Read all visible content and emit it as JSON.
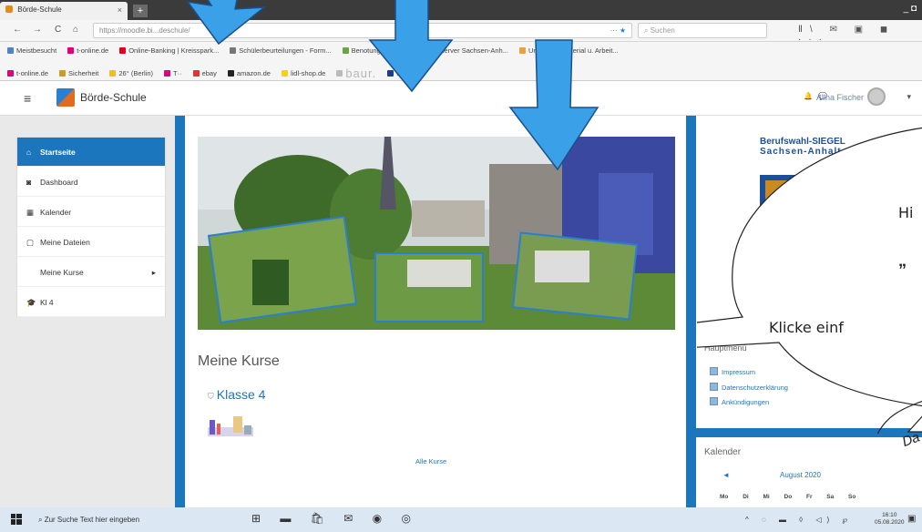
{
  "browser": {
    "tab_title": "Börde-Schule",
    "tab_close": "×",
    "new_tab": "+",
    "window_controls": "_ ◘",
    "nav": {
      "back": "←",
      "forward": "→",
      "reload": "C",
      "home": "⌂"
    },
    "url": "https://moodle.bi...deschule/",
    "url_suffix": "··· ★",
    "search_placeholder": "Suchen",
    "toolbar_icons": "Ⅱ\\ ✉ ▣ ◼ ···",
    "overflow": "···"
  },
  "bookmarks_row1": [
    {
      "label": "Meistbesucht",
      "color": "#4a86c5"
    },
    {
      "label": "t-online.de",
      "color": "#e0007a"
    },
    {
      "label": "Online-Banking | Kreisspark...",
      "color": "#e3001b"
    },
    {
      "label": "Schülerbeurteilungen - Form...",
      "color": "#777777"
    },
    {
      "label": "Benotung | fuxNot...",
      "color": "#6aa33f"
    },
    {
      "label": "...sserver Sachsen-Anh...",
      "color": "#888888"
    },
    {
      "label": "Unterrichtsmaterial u. Arbeit...",
      "color": "#e8a33a"
    }
  ],
  "bookmarks_row2": [
    {
      "label": "t-online.de",
      "color": "#e0007a"
    },
    {
      "label": "Sicherheit",
      "color": "#d09a2a"
    },
    {
      "label": "26° (Berlin)",
      "color": "#f4c20d"
    },
    {
      "label": "T··",
      "color": "#e0007a"
    },
    {
      "label": "ebay",
      "color": "#e53238"
    },
    {
      "label": "amazon.de",
      "color": "#222222"
    },
    {
      "label": "lidl-shop.de",
      "color": "#f7d400"
    },
    {
      "label": "baur.",
      "color": "#bbbbbb"
    },
    {
      "label": "Mobile",
      "color": "#1b3d8b"
    }
  ],
  "header": {
    "menu": "≡",
    "site_name": "Börde-Schule",
    "user_name": "Alina Fischer",
    "bell": "🔔",
    "chat": "💬",
    "caret": "▾"
  },
  "sidebar": {
    "items": [
      {
        "icon": "⌂",
        "label": "Startseite",
        "active": true
      },
      {
        "icon": "◙",
        "label": "Dashboard"
      },
      {
        "icon": "▦",
        "label": "Kalender"
      },
      {
        "icon": "▢",
        "label": "Meine Dateien"
      },
      {
        "icon": "",
        "label": "Meine Kurse",
        "caret": "▸"
      },
      {
        "icon": "🎓",
        "label": "Kl 4"
      }
    ]
  },
  "main": {
    "section_title": "Meine Kurse",
    "course": "Klasse 4",
    "course_icon": "⛉",
    "all_courses": "Alle Kurse"
  },
  "right": {
    "siegel_line1": "Berufswahl-SIEGEL",
    "siegel_line2": "Sachsen-Anhalt",
    "hauptmenu_title": "Hauptmenü",
    "hauptmenu_items": [
      "Impressum",
      "Datenschutzerklärung",
      "Ankündigungen"
    ],
    "calendar_title": "Kalender",
    "calendar_month": "August 2020",
    "calendar_prev": "◄",
    "calendar_days": "Mo Di Mi Do Fr Sa So"
  },
  "bubble": {
    "line1": "Hi",
    "line2": "„",
    "line3": "Klicke einf",
    "line4": "Da"
  },
  "taskbar": {
    "search_placeholder": "Zur Suche Text hier eingeben",
    "task_icons": "⊞ ▬ 🛍 ✉ ◉ ◎",
    "tray": "^ ◌ ▬ ◊ ◁) ℘",
    "time": "16:10",
    "date": "05.08.2020",
    "notifications": "▣"
  }
}
